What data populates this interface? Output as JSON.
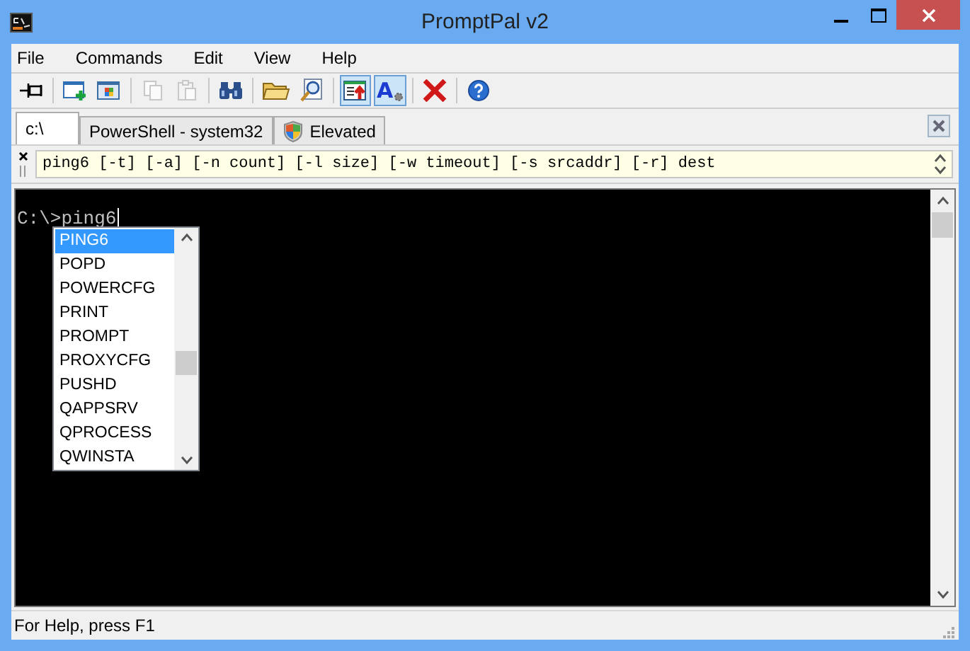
{
  "window": {
    "title": "PromptPal v2"
  },
  "menu": [
    "File",
    "Commands",
    "Edit",
    "View",
    "Help"
  ],
  "toolbar": [
    {
      "kind": "pin",
      "disabled": false,
      "on": false
    },
    {
      "kind": "sep"
    },
    {
      "kind": "new",
      "disabled": false,
      "on": false
    },
    {
      "kind": "window",
      "disabled": false,
      "on": false
    },
    {
      "kind": "sep"
    },
    {
      "kind": "copy",
      "disabled": true,
      "on": false
    },
    {
      "kind": "paste",
      "disabled": true,
      "on": false
    },
    {
      "kind": "sep"
    },
    {
      "kind": "find",
      "disabled": false,
      "on": false
    },
    {
      "kind": "sep"
    },
    {
      "kind": "folder",
      "disabled": false,
      "on": false
    },
    {
      "kind": "zoom",
      "disabled": false,
      "on": false
    },
    {
      "kind": "sep"
    },
    {
      "kind": "ontop",
      "disabled": false,
      "on": true
    },
    {
      "kind": "font",
      "label": "A",
      "disabled": false,
      "on": true
    },
    {
      "kind": "sep"
    },
    {
      "kind": "delete",
      "disabled": false,
      "on": false
    },
    {
      "kind": "sep"
    },
    {
      "kind": "help",
      "disabled": false,
      "on": false
    }
  ],
  "tabs": [
    {
      "label": "c:\\",
      "selected": true,
      "shield": false
    },
    {
      "label": "PowerShell - system32",
      "selected": false,
      "shield": false
    },
    {
      "label": "Elevated",
      "selected": false,
      "shield": true
    }
  ],
  "hint": {
    "text": "ping6 [-t] [-a] [-n count] [-l size] [-w timeout] [-s srcaddr] [-r] dest"
  },
  "console": {
    "prompt": "C:\\>",
    "input": "ping6"
  },
  "completions": [
    {
      "label": "PING6",
      "selected": true
    },
    {
      "label": "POPD",
      "selected": false
    },
    {
      "label": "POWERCFG",
      "selected": false
    },
    {
      "label": "PRINT",
      "selected": false
    },
    {
      "label": "PROMPT",
      "selected": false
    },
    {
      "label": "PROXYCFG",
      "selected": false
    },
    {
      "label": "PUSHD",
      "selected": false
    },
    {
      "label": "QAPPSRV",
      "selected": false
    },
    {
      "label": "QPROCESS",
      "selected": false
    },
    {
      "label": "QWINSTA",
      "selected": false
    }
  ],
  "status_bar": {
    "text": "For Help, press F1"
  }
}
